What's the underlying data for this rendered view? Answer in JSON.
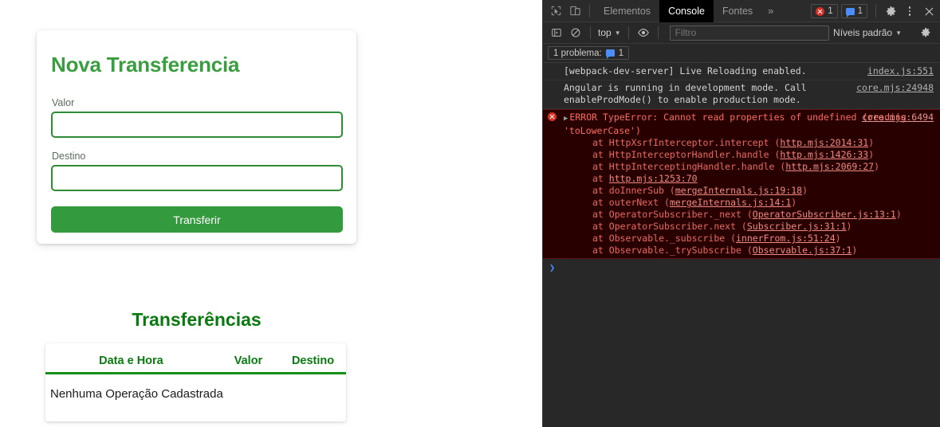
{
  "app": {
    "form": {
      "title": "Nova Transferencia",
      "fields": [
        {
          "label": "Valor",
          "value": "",
          "placeholder": ""
        },
        {
          "label": "Destino",
          "value": "",
          "placeholder": ""
        }
      ],
      "submit_label": "Transferir",
      "accent_title_color": "#3a9e41",
      "accent_border_color": "#2e8b36",
      "accent_button_color": "#349a3e"
    },
    "list": {
      "title": "Transferências",
      "columns": [
        "Data e Hora",
        "Valor",
        "Destino"
      ],
      "empty_message": "Nenhuma Operação Cadastrada",
      "rows": [],
      "accent_color": "#0a7a10"
    }
  },
  "devtools": {
    "tabbar": {
      "inspect_icon": "inspect-cursor-icon",
      "device_icon": "device-toolbar-icon",
      "tabs": [
        {
          "label": "Elementos",
          "active": false
        },
        {
          "label": "Console",
          "active": true
        },
        {
          "label": "Fontes",
          "active": false
        }
      ],
      "overflow_label": "»",
      "error_count": "1",
      "message_count": "1",
      "settings_icon": "gear-icon",
      "more_icon": "kebab-menu-icon",
      "close_icon": "close-icon"
    },
    "console_toolbar": {
      "sidebar_toggle_icon": "console-sidebar-icon",
      "clear_icon": "clear-console-icon",
      "context_label": "top",
      "eye_icon": "live-expression-eye-icon",
      "filter_value": "",
      "filter_placeholder": "Filtro",
      "levels_label": "Níveis padrão",
      "settings_icon": "gear-icon"
    },
    "problems_bar": {
      "label": "1 problema:",
      "count": "1"
    },
    "log": [
      {
        "type": "info",
        "text": "[webpack-dev-server] Live Reloading enabled.",
        "source": "index.js:551"
      },
      {
        "type": "info",
        "text": "Angular is running in development mode. Call enableProdMode() to enable production mode.",
        "source": "core.mjs:24948"
      }
    ],
    "error_entry": {
      "prefix": "ERROR ",
      "message": "TypeError: Cannot read properties of undefined (reading 'toLowerCase')",
      "source": "core.mjs:6494",
      "stack": [
        {
          "fn": "at HttpXsrfInterceptor.intercept (",
          "link": "http.mjs:2014:31",
          "close": ")"
        },
        {
          "fn": "at HttpInterceptorHandler.handle (",
          "link": "http.mjs:1426:33",
          "close": ")"
        },
        {
          "fn": "at HttpInterceptingHandler.handle (",
          "link": "http.mjs:2069:27",
          "close": ")"
        },
        {
          "fn": "at ",
          "link": "http.mjs:1253:70",
          "close": ""
        },
        {
          "fn": "at doInnerSub (",
          "link": "mergeInternals.js:19:18",
          "close": ")"
        },
        {
          "fn": "at outerNext (",
          "link": "mergeInternals.js:14:1",
          "close": ")"
        },
        {
          "fn": "at OperatorSubscriber._next (",
          "link": "OperatorSubscriber.js:13:1",
          "close": ")"
        },
        {
          "fn": "at OperatorSubscriber.next (",
          "link": "Subscriber.js:31:1",
          "close": ")"
        },
        {
          "fn": "at Observable._subscribe (",
          "link": "innerFrom.js:51:24",
          "close": ")"
        },
        {
          "fn": "at Observable._trySubscribe (",
          "link": "Observable.js:37:1",
          "close": ")"
        }
      ]
    },
    "prompt": {
      "chevron": "❯",
      "value": ""
    }
  }
}
